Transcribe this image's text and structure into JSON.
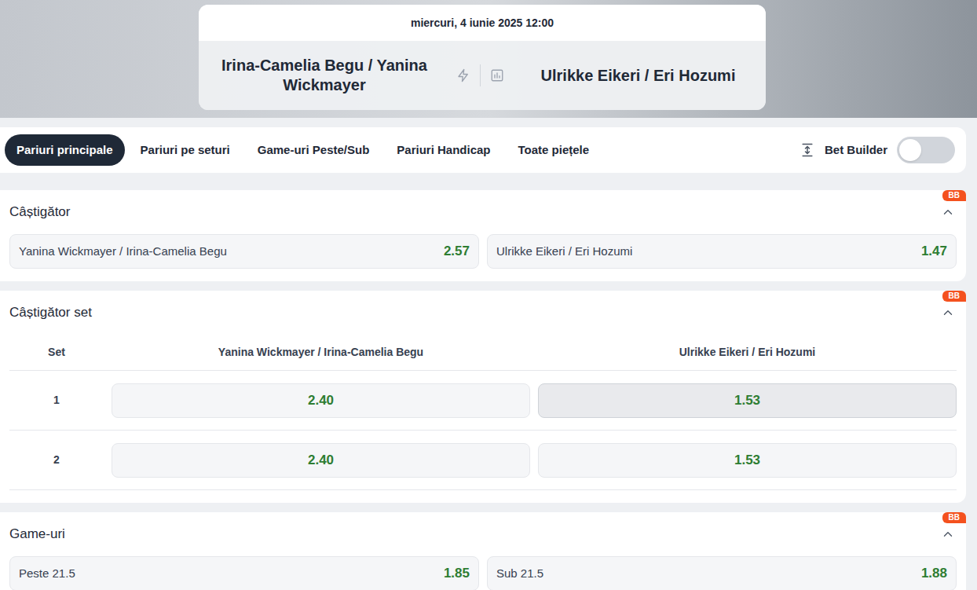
{
  "event": {
    "datetime": "miercuri, 4 iunie 2025 12:00",
    "home": "Irina-Camelia Begu / Yanina Wickmayer",
    "away": "Ulrikke Eikeri / Eri Hozumi"
  },
  "tabs": [
    {
      "label": "Pariuri principale",
      "selected": true
    },
    {
      "label": "Pariuri pe seturi",
      "selected": false
    },
    {
      "label": "Game-uri Peste/Sub",
      "selected": false
    },
    {
      "label": "Pariuri Handicap",
      "selected": false
    },
    {
      "label": "Toate piețele",
      "selected": false
    }
  ],
  "bet_builder": {
    "label": "Bet Builder",
    "on": false
  },
  "markets": [
    {
      "kind": "two-way",
      "title": "Câștigător",
      "badge": "BB",
      "expanded": true,
      "selections": [
        {
          "label": "Yanina Wickmayer / Irina-Camelia Begu",
          "odds": "2.57"
        },
        {
          "label": "Ulrikke Eikeri / Eri Hozumi",
          "odds": "1.47"
        }
      ]
    },
    {
      "kind": "set-table",
      "title": "Câștigător set",
      "badge": "BB",
      "expanded": true,
      "columns": [
        "Set",
        "Yanina Wickmayer / Irina-Camelia Begu",
        "Ulrikke Eikeri / Eri Hozumi"
      ],
      "rows": [
        {
          "set": "1",
          "odds": [
            {
              "value": "2.40",
              "selected": false
            },
            {
              "value": "1.53",
              "selected": true
            }
          ]
        },
        {
          "set": "2",
          "odds": [
            {
              "value": "2.40",
              "selected": false
            },
            {
              "value": "1.53",
              "selected": false
            }
          ]
        }
      ]
    },
    {
      "kind": "two-way",
      "title": "Game-uri",
      "badge": "BB",
      "expanded": true,
      "selections": [
        {
          "label": "Peste 21.5",
          "odds": "1.85"
        },
        {
          "label": "Sub 21.5",
          "odds": "1.88"
        }
      ]
    }
  ]
}
